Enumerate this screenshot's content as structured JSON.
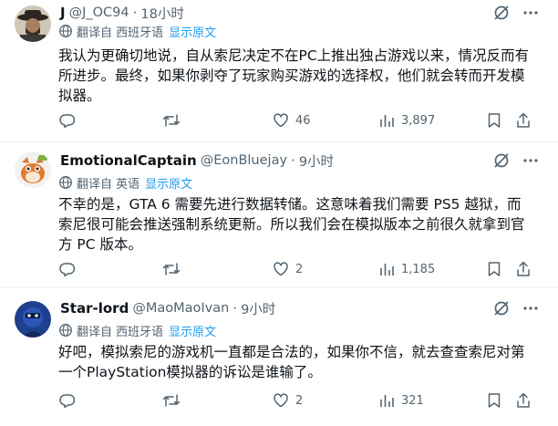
{
  "tweets": [
    {
      "name": "J",
      "handle": "@J_OC94",
      "time": "18小时",
      "translate_label": "翻译自 西班牙语",
      "show_original": "显示原文",
      "body": "我认为更确切地说，自从索尼决定不在PC上推出独占游戏以来，情况反而有所进步。最终，如果你剥夺了玩家购买游戏的选择权，他们就会转而开发模拟器。",
      "replies": "",
      "retweets": "",
      "likes": "46",
      "views": "3,897"
    },
    {
      "name": "EmotionalCaptain",
      "handle": "@EonBluejay",
      "time": "9小时",
      "translate_label": "翻译自 英语",
      "show_original": "显示原文",
      "body": "不幸的是，GTA 6 需要先进行数据转储。这意味着我们需要 PS5 越狱，而索尼很可能会推送强制系统更新。所以我们会在模拟版本之前很久就拿到官方 PC 版本。",
      "replies": "",
      "retweets": "",
      "likes": "2",
      "views": "1,185"
    },
    {
      "name": "Star-lord",
      "handle": "@MaoMaoIvan",
      "time": "9小时",
      "translate_label": "翻译自 西班牙语",
      "show_original": "显示原文",
      "body": "好吧，模拟索尼的游戏机一直都是合法的，如果你不信，就去查查索尼对第一个PlayStation模拟器的诉讼是谁输了。",
      "replies": "",
      "retweets": "",
      "likes": "2",
      "views": "321"
    }
  ],
  "icons": {
    "grok": "grok-icon",
    "more": "more-icon",
    "translate": "translate-icon",
    "reply": "reply-icon",
    "retweet": "retweet-icon",
    "like": "like-icon",
    "views": "views-icon",
    "bookmark": "bookmark-icon",
    "share": "share-icon"
  },
  "colors": {
    "text": "#0f1419",
    "muted": "#536471",
    "link": "#1d9bf0",
    "divider": "#eff3f4"
  }
}
